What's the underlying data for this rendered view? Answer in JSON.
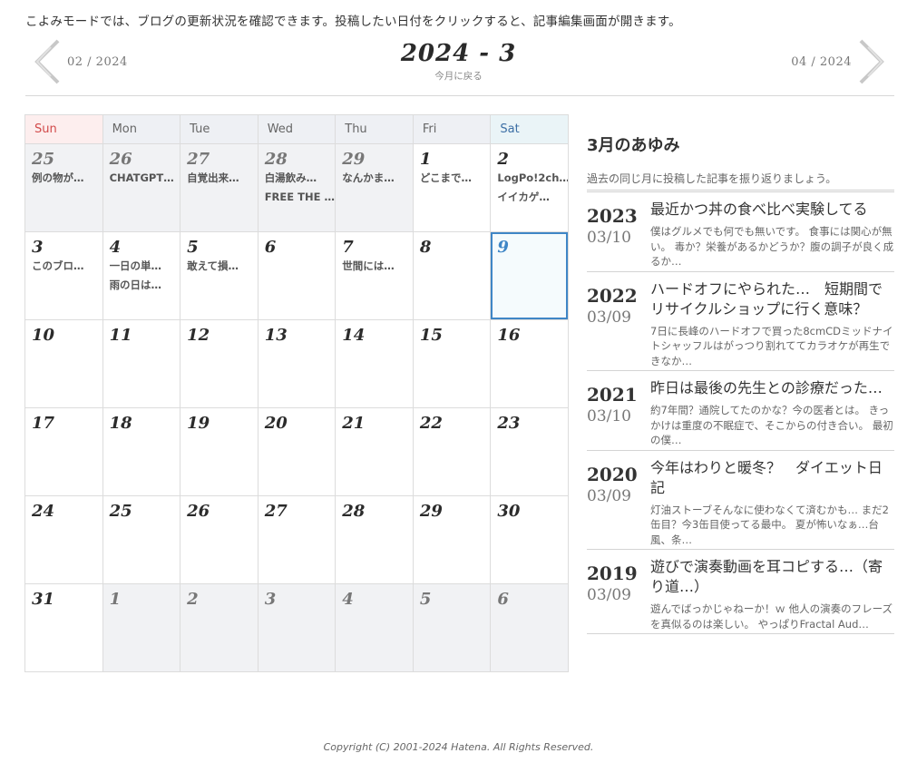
{
  "intro": "こよみモードでは、ブログの更新状況を確認できます。投稿したい日付をクリックすると、記事編集画面が開きます。",
  "nav": {
    "prev": "02 / 2024",
    "next": "04 / 2024",
    "current": "2024 - 3",
    "back": "今月に戻る"
  },
  "weekdays": [
    "Sun",
    "Mon",
    "Tue",
    "Wed",
    "Thu",
    "Fri",
    "Sat"
  ],
  "calendar": [
    [
      {
        "day": "25",
        "other": true,
        "posts": [
          "例の物が…"
        ]
      },
      {
        "day": "26",
        "other": true,
        "posts": [
          "CHATGPT…"
        ]
      },
      {
        "day": "27",
        "other": true,
        "posts": [
          "自覚出来…"
        ]
      },
      {
        "day": "28",
        "other": true,
        "posts": [
          "白湯飲み…",
          "FREE THE …"
        ]
      },
      {
        "day": "29",
        "other": true,
        "posts": [
          "なんかま…"
        ]
      },
      {
        "day": "1",
        "posts": [
          "どこまで…"
        ]
      },
      {
        "day": "2",
        "posts": [
          "LogPo!2ch…",
          "イイカゲ…"
        ]
      }
    ],
    [
      {
        "day": "3",
        "posts": [
          "このブロ…"
        ]
      },
      {
        "day": "4",
        "posts": [
          "一日の単…",
          "雨の日は…"
        ]
      },
      {
        "day": "5",
        "posts": [
          "敢えて損…"
        ]
      },
      {
        "day": "6",
        "posts": []
      },
      {
        "day": "7",
        "posts": [
          "世間には…"
        ]
      },
      {
        "day": "8",
        "posts": []
      },
      {
        "day": "9",
        "today": true,
        "posts": []
      }
    ],
    [
      {
        "day": "10",
        "posts": []
      },
      {
        "day": "11",
        "posts": []
      },
      {
        "day": "12",
        "posts": []
      },
      {
        "day": "13",
        "posts": []
      },
      {
        "day": "14",
        "posts": []
      },
      {
        "day": "15",
        "posts": []
      },
      {
        "day": "16",
        "posts": []
      }
    ],
    [
      {
        "day": "17",
        "posts": []
      },
      {
        "day": "18",
        "posts": []
      },
      {
        "day": "19",
        "posts": []
      },
      {
        "day": "20",
        "posts": []
      },
      {
        "day": "21",
        "posts": []
      },
      {
        "day": "22",
        "posts": []
      },
      {
        "day": "23",
        "posts": []
      }
    ],
    [
      {
        "day": "24",
        "posts": []
      },
      {
        "day": "25",
        "posts": []
      },
      {
        "day": "26",
        "posts": []
      },
      {
        "day": "27",
        "posts": []
      },
      {
        "day": "28",
        "posts": []
      },
      {
        "day": "29",
        "posts": []
      },
      {
        "day": "30",
        "posts": []
      }
    ],
    [
      {
        "day": "31",
        "posts": []
      },
      {
        "day": "1",
        "other": true,
        "posts": []
      },
      {
        "day": "2",
        "other": true,
        "posts": []
      },
      {
        "day": "3",
        "other": true,
        "posts": []
      },
      {
        "day": "4",
        "other": true,
        "posts": []
      },
      {
        "day": "5",
        "other": true,
        "posts": []
      },
      {
        "day": "6",
        "other": true,
        "posts": []
      }
    ]
  ],
  "sidebar": {
    "heading": "3月のあゆみ",
    "lead": "過去の同じ月に投稿した記事を振り返りましょう。",
    "entries": [
      {
        "year": "2023",
        "date": "03/10",
        "title": "最近かつ丼の食べ比べ実験してる",
        "summary": "僕はグルメでも何でも無いです。 食事には関心が無い。 毒か？栄養があるかどうか？腹の調子が良く成るか…"
      },
      {
        "year": "2022",
        "date": "03/09",
        "title": "ハードオフにやられた…　短期間でリサイクルショップに行く意味？",
        "summary": "7日に長峰のハードオフで買った8cmCDミッドナイトシャッフルはがっつり割れててカラオケが再生できなか…"
      },
      {
        "year": "2021",
        "date": "03/10",
        "title": "昨日は最後の先生との診療だった…",
        "summary": "約7年間？通院してたのかな？今の医者とは。 きっかけは重度の不眠症で、そこからの付き合い。 最初の僕…"
      },
      {
        "year": "2020",
        "date": "03/09",
        "title": "今年はわりと暖冬？　ダイエット日記",
        "summary": "灯油ストーブそんなに使わなくて済むかも… まだ2缶目？今3缶目使ってる最中。 夏が怖いなぁ…台風、条…"
      },
      {
        "year": "2019",
        "date": "03/09",
        "title": "遊びで演奏動画を耳コピする…（寄り道…）",
        "summary": "遊んでばっかじゃねーか！ｗ 他人の演奏のフレーズを真似るのは楽しい。 やっぱりFractal Aud…"
      }
    ]
  },
  "footer": "Copyright (C) 2001-2024 Hatena. All Rights Reserved."
}
